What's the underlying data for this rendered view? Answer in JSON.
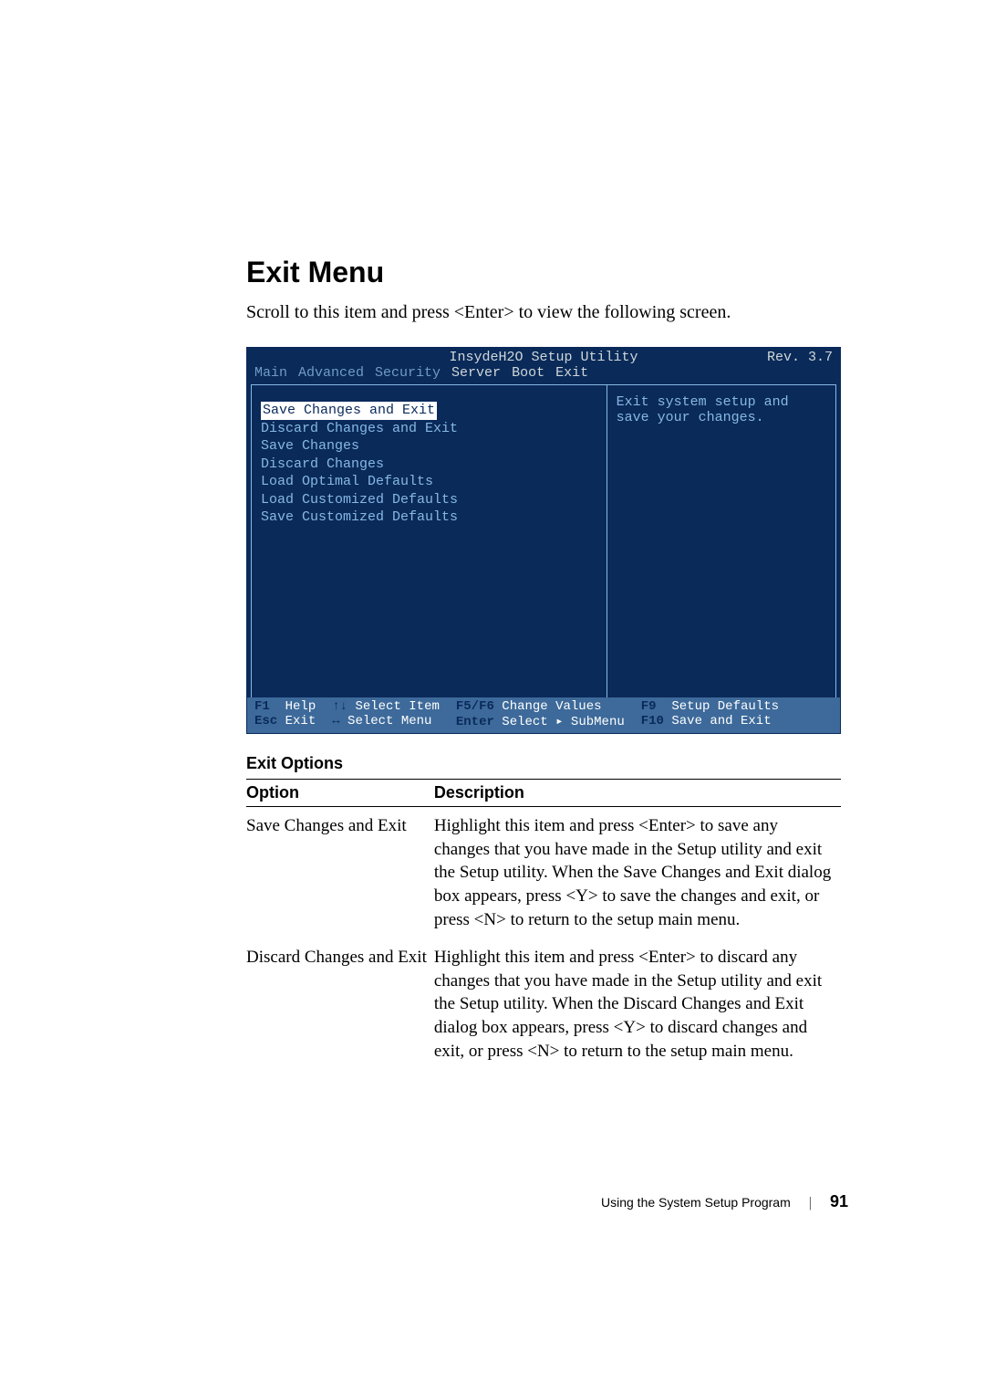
{
  "heading": "Exit Menu",
  "intro": "Scroll to this item and press <Enter> to view the following screen.",
  "bios": {
    "title": "InsydeH2O Setup Utility",
    "rev": "Rev. 3.7",
    "menubar": [
      "Main",
      "Advanced",
      "Security",
      "Server",
      "Boot",
      "Exit"
    ],
    "items": [
      "Save Changes and Exit",
      "Discard Changes and Exit",
      "Save Changes",
      "Discard Changes",
      "Load Optimal Defaults",
      "Load Customized Defaults",
      "Save Customized Defaults"
    ],
    "help_text_1": "Exit system setup and",
    "help_text_2": "save your changes.",
    "footer": {
      "f1": "F1",
      "f1_label": "Help",
      "updown": "↑↓",
      "updown_label": "Select Item",
      "f5f6": "F5/F6",
      "f5f6_label": "Change Values",
      "f9": "F9",
      "f9_label": "Setup Defaults",
      "esc": "Esc",
      "esc_label": "Exit",
      "lr": "↔",
      "lr_label": "Select Menu",
      "enter": "Enter",
      "enter_label": "Select ▸ SubMenu",
      "f10": "F10",
      "f10_label": "Save and Exit"
    }
  },
  "table": {
    "title": "Exit Options",
    "headers": {
      "option": "Option",
      "description": "Description"
    },
    "rows": [
      {
        "option": "Save Changes and Exit",
        "description": "Highlight this item and press <Enter> to save any changes that you have made in the Setup utility and exit the Setup utility. When the Save Changes and Exit dialog box appears, press <Y> to save the changes and exit, or press <N> to return to the setup main menu."
      },
      {
        "option": "Discard Changes and Exit",
        "description": "Highlight this item and press <Enter> to discard any changes that you have made in the Setup utility and exit the Setup utility. When the Discard Changes and Exit dialog box appears, press <Y> to discard changes and exit, or press <N> to return to the setup main menu."
      }
    ]
  },
  "footer": {
    "label": "Using the System Setup Program",
    "page": "91"
  }
}
